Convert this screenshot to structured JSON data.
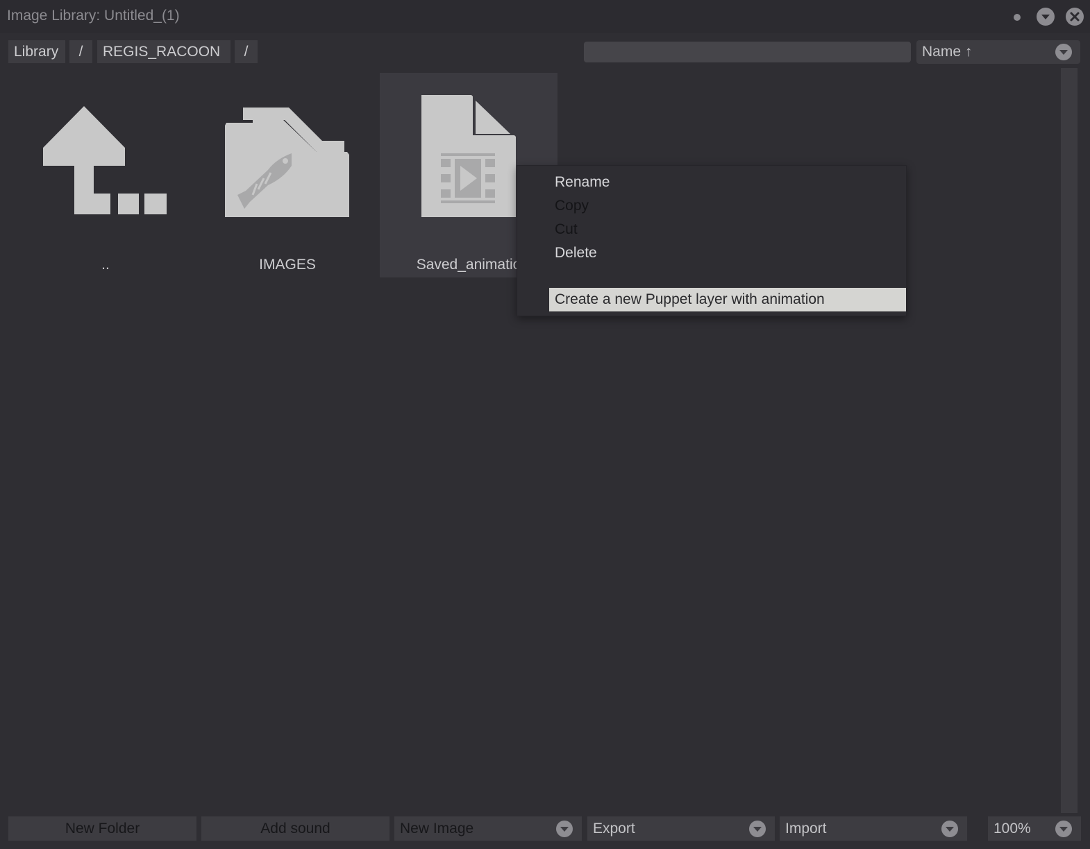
{
  "window": {
    "title": "Image Library: Untitled_(1)"
  },
  "breadcrumb": {
    "root": "Library",
    "sep1": "/",
    "folder": "REGIS_RACOON",
    "sep2": "/"
  },
  "search": {
    "value": "",
    "placeholder": ""
  },
  "sort": {
    "label": "Name ↑"
  },
  "items": [
    {
      "label": "..",
      "icon": "parent-folder-icon"
    },
    {
      "label": "IMAGES",
      "icon": "folder-icon"
    },
    {
      "label": "Saved_animatio",
      "icon": "animation-file-icon",
      "selected": true
    }
  ],
  "context_menu": {
    "rename": "Rename",
    "copy": "Copy",
    "cut": "Cut",
    "delete": "Delete",
    "create_puppet": "Create a new Puppet layer with animation"
  },
  "bottom": {
    "new_folder": "New Folder",
    "add_sound": "Add sound",
    "new_image": "New Image",
    "export": "Export",
    "import": "Import",
    "zoom": "100%"
  },
  "colors": {
    "background": "#2f2e33",
    "icon_fill": "#c8c8c8",
    "highlight": "#d5d5d2"
  }
}
